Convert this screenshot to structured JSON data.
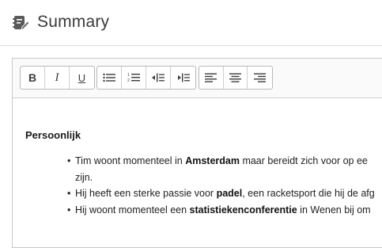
{
  "header": {
    "title": "Summary",
    "icon": "notebook-pen-icon"
  },
  "toolbar": {
    "groups": [
      {
        "buttons": [
          "bold-icon",
          "italic-icon",
          "underline-icon"
        ]
      },
      {
        "buttons": [
          "bullet-list-icon",
          "numbered-list-icon",
          "outdent-icon",
          "indent-icon"
        ]
      },
      {
        "buttons": [
          "align-left-icon",
          "align-center-icon",
          "align-right-icon"
        ]
      }
    ],
    "bold_label": "B",
    "italic_label": "I",
    "underline_label": "U"
  },
  "document": {
    "heading": "Persoonlijk",
    "bullets": [
      {
        "parts": [
          "Tim woont momenteel in ",
          "Amsterdam",
          " maar bereidt zich voor op ee"
        ],
        "continuation": "zijn."
      },
      {
        "parts": [
          "Hij heeft een sterke passie voor ",
          "padel",
          ", een racketsport die hij de afg"
        ]
      },
      {
        "parts": [
          "Hij woont momenteel een ",
          "statistiekenconferentie",
          " in Wenen bij om"
        ]
      }
    ]
  }
}
